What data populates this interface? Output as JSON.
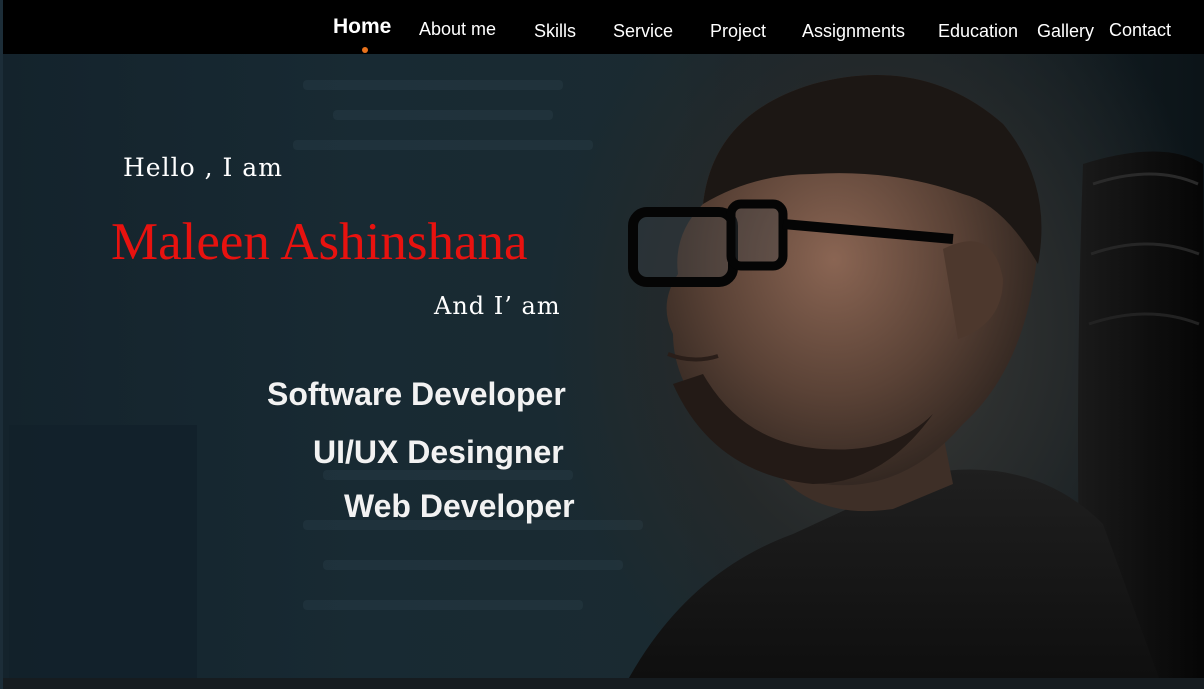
{
  "nav": {
    "items": [
      {
        "label": "Home",
        "active": true
      },
      {
        "label": "About me",
        "active": false
      },
      {
        "label": "Skills",
        "active": false
      },
      {
        "label": "Service",
        "active": false
      },
      {
        "label": "Project",
        "active": false
      },
      {
        "label": "Assignments",
        "active": false
      },
      {
        "label": "Education",
        "active": false
      },
      {
        "label": "Gallery",
        "active": false
      },
      {
        "label": "Contact",
        "active": false
      }
    ],
    "active_indicator_color": "#e8721c"
  },
  "hero": {
    "greeting": "Hello , I am",
    "name": "Maleen Ashinshana",
    "name_color": "#e8120f",
    "and_text": "And I’ am",
    "roles": [
      "Software Developer",
      "UI/UX Desingner",
      "Web Developer"
    ]
  }
}
